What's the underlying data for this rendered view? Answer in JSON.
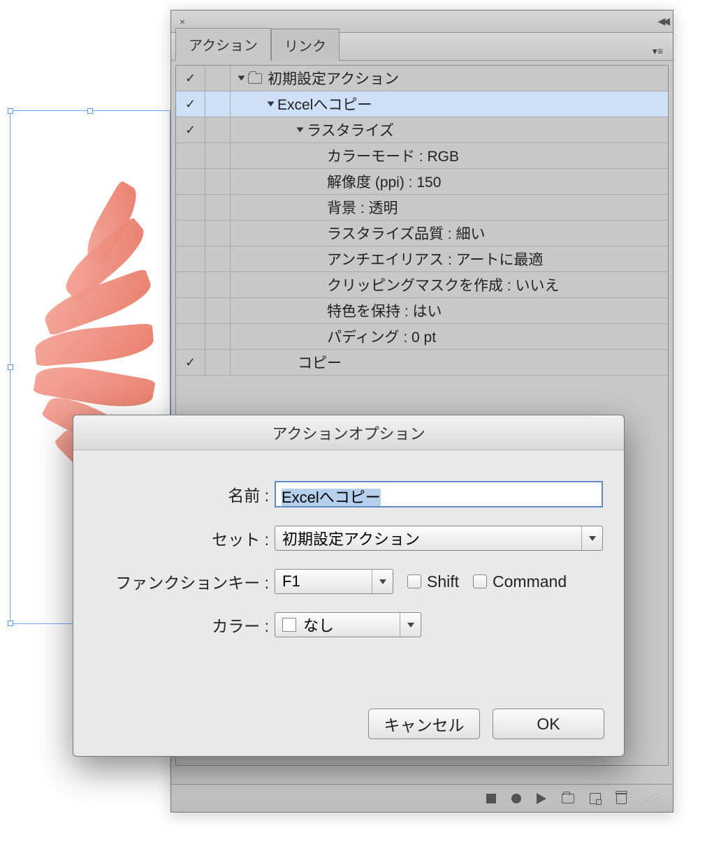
{
  "panel": {
    "tabs": [
      {
        "label": "アクション",
        "active": true
      },
      {
        "label": "リンク",
        "active": false
      }
    ],
    "items": [
      {
        "check": true,
        "indent": 0,
        "tri": true,
        "folder": true,
        "label": "初期設定アクション",
        "selected": false
      },
      {
        "check": true,
        "indent": 1,
        "tri": true,
        "folder": false,
        "label": "Excelへコピー",
        "selected": true
      },
      {
        "check": true,
        "indent": 2,
        "tri": true,
        "folder": false,
        "label": "ラスタライズ",
        "selected": false
      },
      {
        "check": false,
        "indent": 3,
        "tri": false,
        "folder": false,
        "label": "カラーモード : RGB",
        "selected": false
      },
      {
        "check": false,
        "indent": 3,
        "tri": false,
        "folder": false,
        "label": "解像度 (ppi) : 150",
        "selected": false
      },
      {
        "check": false,
        "indent": 3,
        "tri": false,
        "folder": false,
        "label": "背景 : 透明",
        "selected": false
      },
      {
        "check": false,
        "indent": 3,
        "tri": false,
        "folder": false,
        "label": "ラスタライズ品質 : 細い",
        "selected": false
      },
      {
        "check": false,
        "indent": 3,
        "tri": false,
        "folder": false,
        "label": "アンチエイリアス : アートに最適",
        "selected": false
      },
      {
        "check": false,
        "indent": 3,
        "tri": false,
        "folder": false,
        "label": "クリッピングマスクを作成 : いいえ",
        "selected": false
      },
      {
        "check": false,
        "indent": 3,
        "tri": false,
        "folder": false,
        "label": "特色を保持 : はい",
        "selected": false
      },
      {
        "check": false,
        "indent": 3,
        "tri": false,
        "folder": false,
        "label": "パディング : 0 pt",
        "selected": false
      },
      {
        "check": true,
        "indent": 2,
        "tri": false,
        "folder": false,
        "label": "コピー",
        "selected": false
      }
    ]
  },
  "dialog": {
    "title": "アクションオプション",
    "labels": {
      "name": "名前 :",
      "set": "セット :",
      "fkey": "ファンクションキー :",
      "color": "カラー :",
      "shift": "Shift",
      "command": "Command"
    },
    "values": {
      "name": "Excelへコピー",
      "set": "初期設定アクション",
      "fkey": "F1",
      "color": "なし",
      "shift_checked": false,
      "command_checked": false
    },
    "buttons": {
      "cancel": "キャンセル",
      "ok": "OK"
    }
  }
}
